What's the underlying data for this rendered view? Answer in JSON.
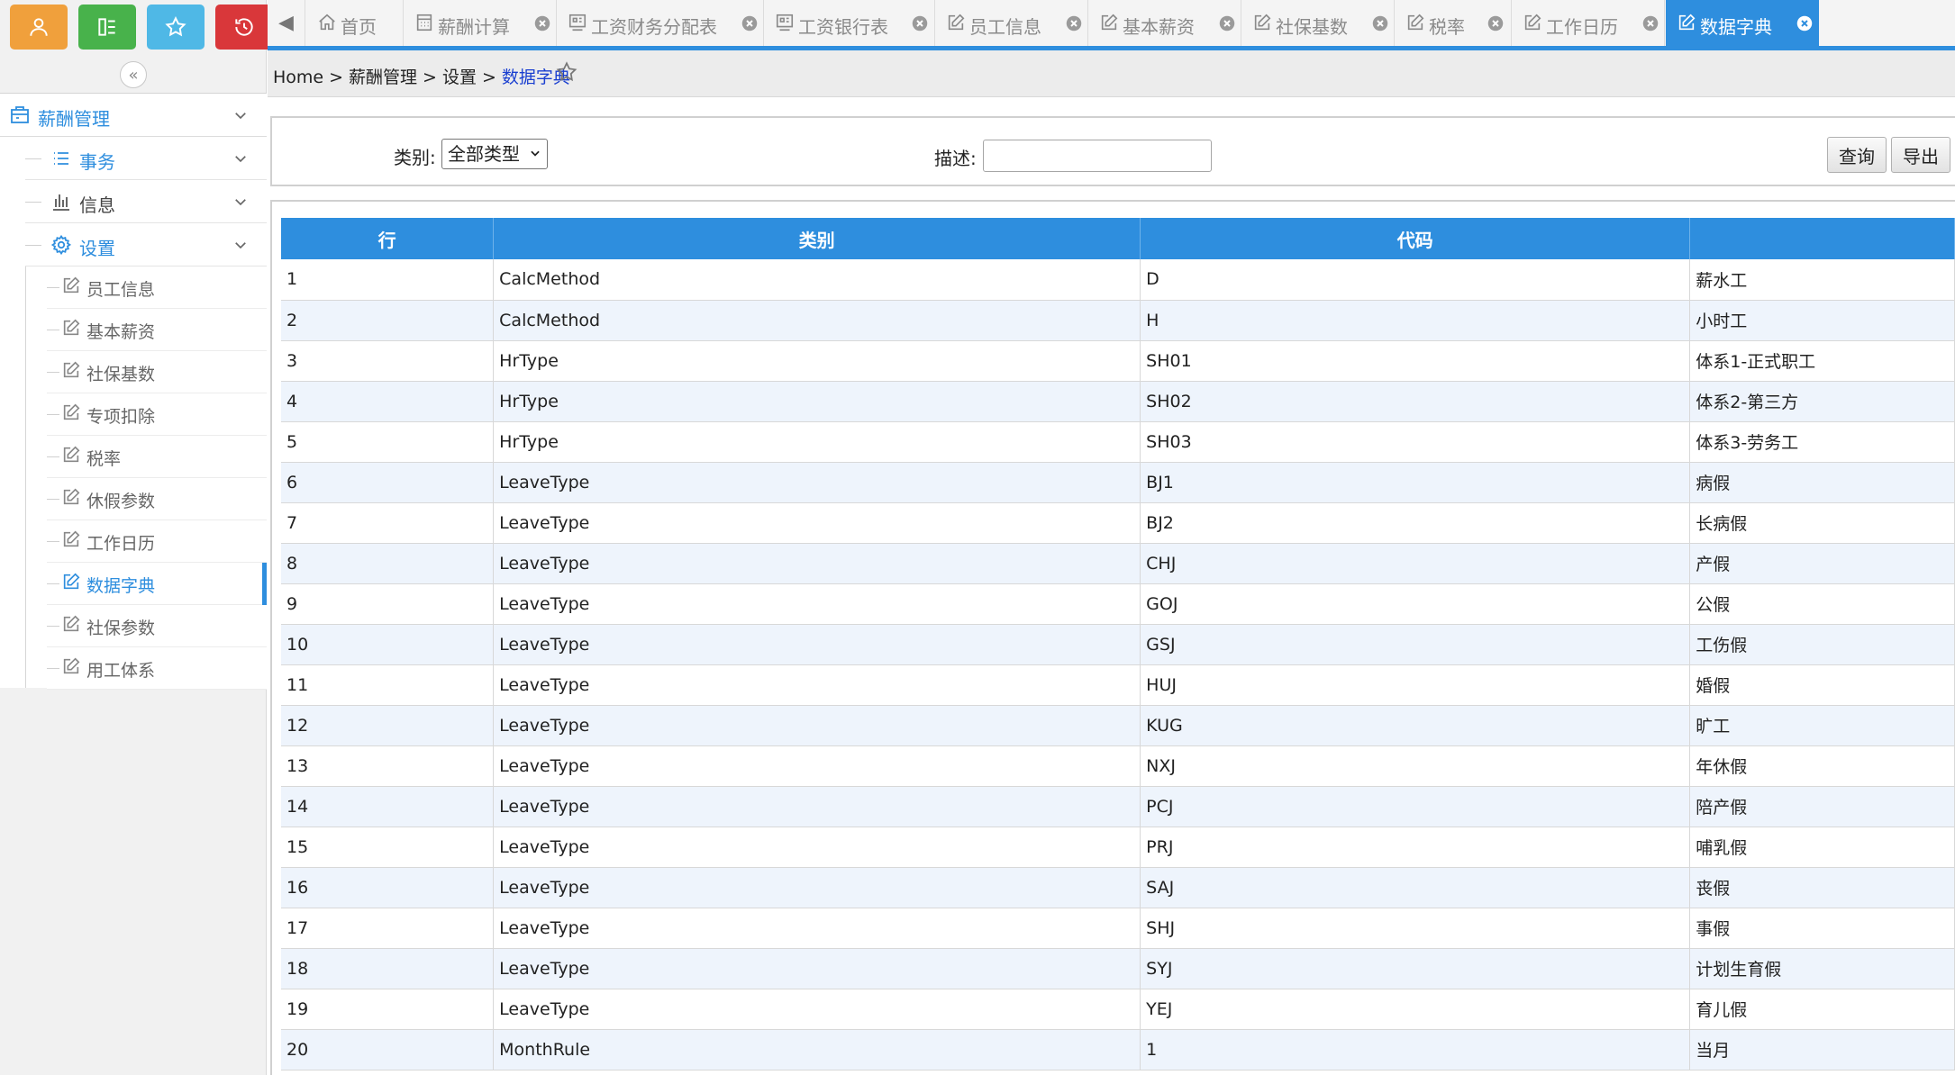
{
  "quick_buttons": [
    {
      "name": "user-quick-button",
      "icon": "user-icon",
      "color": "#f0a03c"
    },
    {
      "name": "menu-quick-button",
      "icon": "menu-icon",
      "color": "#48b24b"
    },
    {
      "name": "favorites-quick-button",
      "icon": "star-icon",
      "color": "#4fb8e6"
    },
    {
      "name": "history-quick-button",
      "icon": "history-icon",
      "color": "#d9373a"
    }
  ],
  "sidebar": {
    "root_label": "薪酬管理",
    "groups": [
      {
        "label": "事务",
        "icon": "list-icon"
      },
      {
        "label": "信息",
        "icon": "bar-chart-icon"
      },
      {
        "label": "设置",
        "icon": "gear-icon"
      }
    ],
    "settings_items": [
      "员工信息",
      "基本薪资",
      "社保基数",
      "专项扣除",
      "税率",
      "休假参数",
      "工作日历",
      "数据字典",
      "社保参数",
      "用工体系"
    ],
    "active_item": "数据字典"
  },
  "tabs": [
    {
      "label": "首页",
      "icon": "home-icon",
      "closable": false
    },
    {
      "label": "薪酬计算",
      "icon": "calculator-icon",
      "closable": true
    },
    {
      "label": "工资财务分配表",
      "icon": "report-icon",
      "closable": true
    },
    {
      "label": "工资银行表",
      "icon": "report-icon",
      "closable": true
    },
    {
      "label": "员工信息",
      "icon": "edit-icon",
      "closable": true
    },
    {
      "label": "基本薪资",
      "icon": "edit-icon",
      "closable": true
    },
    {
      "label": "社保基数",
      "icon": "edit-icon",
      "closable": true
    },
    {
      "label": "税率",
      "icon": "edit-icon",
      "closable": true
    },
    {
      "label": "工作日历",
      "icon": "edit-icon",
      "closable": true
    },
    {
      "label": "数据字典",
      "icon": "edit-icon",
      "closable": true,
      "active": true
    }
  ],
  "breadcrumb": {
    "home": "Home",
    "sep": ">",
    "level1": "薪酬管理",
    "level2": "设置",
    "current": "数据字典"
  },
  "search": {
    "type_label": "类别:",
    "type_value": "全部类型",
    "desc_label": "描述:",
    "desc_value": "",
    "query_button": "查询",
    "export_button": "导出"
  },
  "table": {
    "columns": [
      "行",
      "类别",
      "代码",
      ""
    ],
    "rows": [
      [
        "1",
        "CalcMethod",
        "D",
        "薪水工"
      ],
      [
        "2",
        "CalcMethod",
        "H",
        "小时工"
      ],
      [
        "3",
        "HrType",
        "SH01",
        "体系1-正式职工"
      ],
      [
        "4",
        "HrType",
        "SH02",
        "体系2-第三方"
      ],
      [
        "5",
        "HrType",
        "SH03",
        "体系3-劳务工"
      ],
      [
        "6",
        "LeaveType",
        "BJ1",
        "病假"
      ],
      [
        "7",
        "LeaveType",
        "BJ2",
        "长病假"
      ],
      [
        "8",
        "LeaveType",
        "CHJ",
        "产假"
      ],
      [
        "9",
        "LeaveType",
        "GOJ",
        "公假"
      ],
      [
        "10",
        "LeaveType",
        "GSJ",
        "工伤假"
      ],
      [
        "11",
        "LeaveType",
        "HUJ",
        "婚假"
      ],
      [
        "12",
        "LeaveType",
        "KUG",
        "旷工"
      ],
      [
        "13",
        "LeaveType",
        "NXJ",
        "年休假"
      ],
      [
        "14",
        "LeaveType",
        "PCJ",
        "陪产假"
      ],
      [
        "15",
        "LeaveType",
        "PRJ",
        "哺乳假"
      ],
      [
        "16",
        "LeaveType",
        "SAJ",
        "丧假"
      ],
      [
        "17",
        "LeaveType",
        "SHJ",
        "事假"
      ],
      [
        "18",
        "LeaveType",
        "SYJ",
        "计划生育假"
      ],
      [
        "19",
        "LeaveType",
        "YEJ",
        "育儿假"
      ],
      [
        "20",
        "MonthRule",
        "1",
        "当月"
      ]
    ]
  },
  "colors": {
    "accent": "#2e8ede",
    "header_text": "#ffffff",
    "row_alt": "#eef4fc"
  }
}
